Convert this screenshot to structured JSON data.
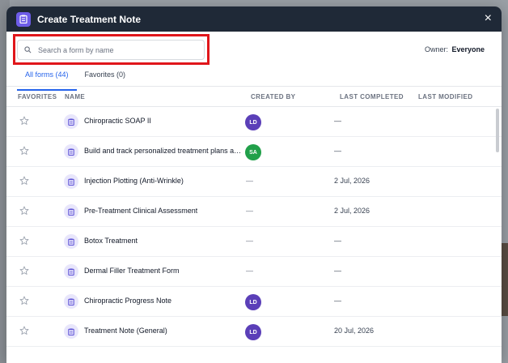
{
  "modal": {
    "title": "Create Treatment Note",
    "close_label": "×"
  },
  "search": {
    "placeholder": "Search a form by name",
    "value": ""
  },
  "owner": {
    "label": "Owner:",
    "value": "Everyone"
  },
  "tabs": [
    {
      "label": "All forms (44)",
      "active": true
    },
    {
      "label": "Favorites (0)",
      "active": false
    }
  ],
  "columns": {
    "favorites": "FAVORITES",
    "name": "NAME",
    "created_by": "CREATED BY",
    "last_completed": "LAST COMPLETED",
    "last_modified": "LAST MODIFIED"
  },
  "rows": [
    {
      "name": "Chiropractic SOAP II",
      "created_by": "LD",
      "avatar_color": "#5b3fb8",
      "last_completed": "—",
      "last_modified": ""
    },
    {
      "name": "Build and track personalized treatment plans ac...",
      "created_by": "SA",
      "avatar_color": "#21a04a",
      "last_completed": "—",
      "last_modified": ""
    },
    {
      "name": "Injection Plotting (Anti-Wrinkle)",
      "created_by": "—",
      "avatar_color": "",
      "last_completed": "2 Jul, 2026",
      "last_modified": ""
    },
    {
      "name": "Pre-Treatment Clinical Assessment",
      "created_by": "—",
      "avatar_color": "",
      "last_completed": "2 Jul, 2026",
      "last_modified": ""
    },
    {
      "name": "Botox Treatment",
      "created_by": "—",
      "avatar_color": "",
      "last_completed": "—",
      "last_modified": ""
    },
    {
      "name": "Dermal Filler Treatment Form",
      "created_by": "—",
      "avatar_color": "",
      "last_completed": "—",
      "last_modified": ""
    },
    {
      "name": "Chiropractic Progress Note",
      "created_by": "LD",
      "avatar_color": "#5b3fb8",
      "last_completed": "—",
      "last_modified": ""
    },
    {
      "name": "Treatment Note (General)",
      "created_by": "LD",
      "avatar_color": "#5b3fb8",
      "last_completed": "20 Jul, 2026",
      "last_modified": ""
    }
  ],
  "colors": {
    "accent": "#2563eb",
    "header_bg": "#1f2937",
    "highlight": "#e0161b",
    "icon_purple": "#6d5ce8"
  },
  "icons": {
    "header": "clipboard-icon",
    "search": "search-icon",
    "favorite": "star-outline-icon",
    "form": "clipboard-icon",
    "close": "close-icon"
  }
}
